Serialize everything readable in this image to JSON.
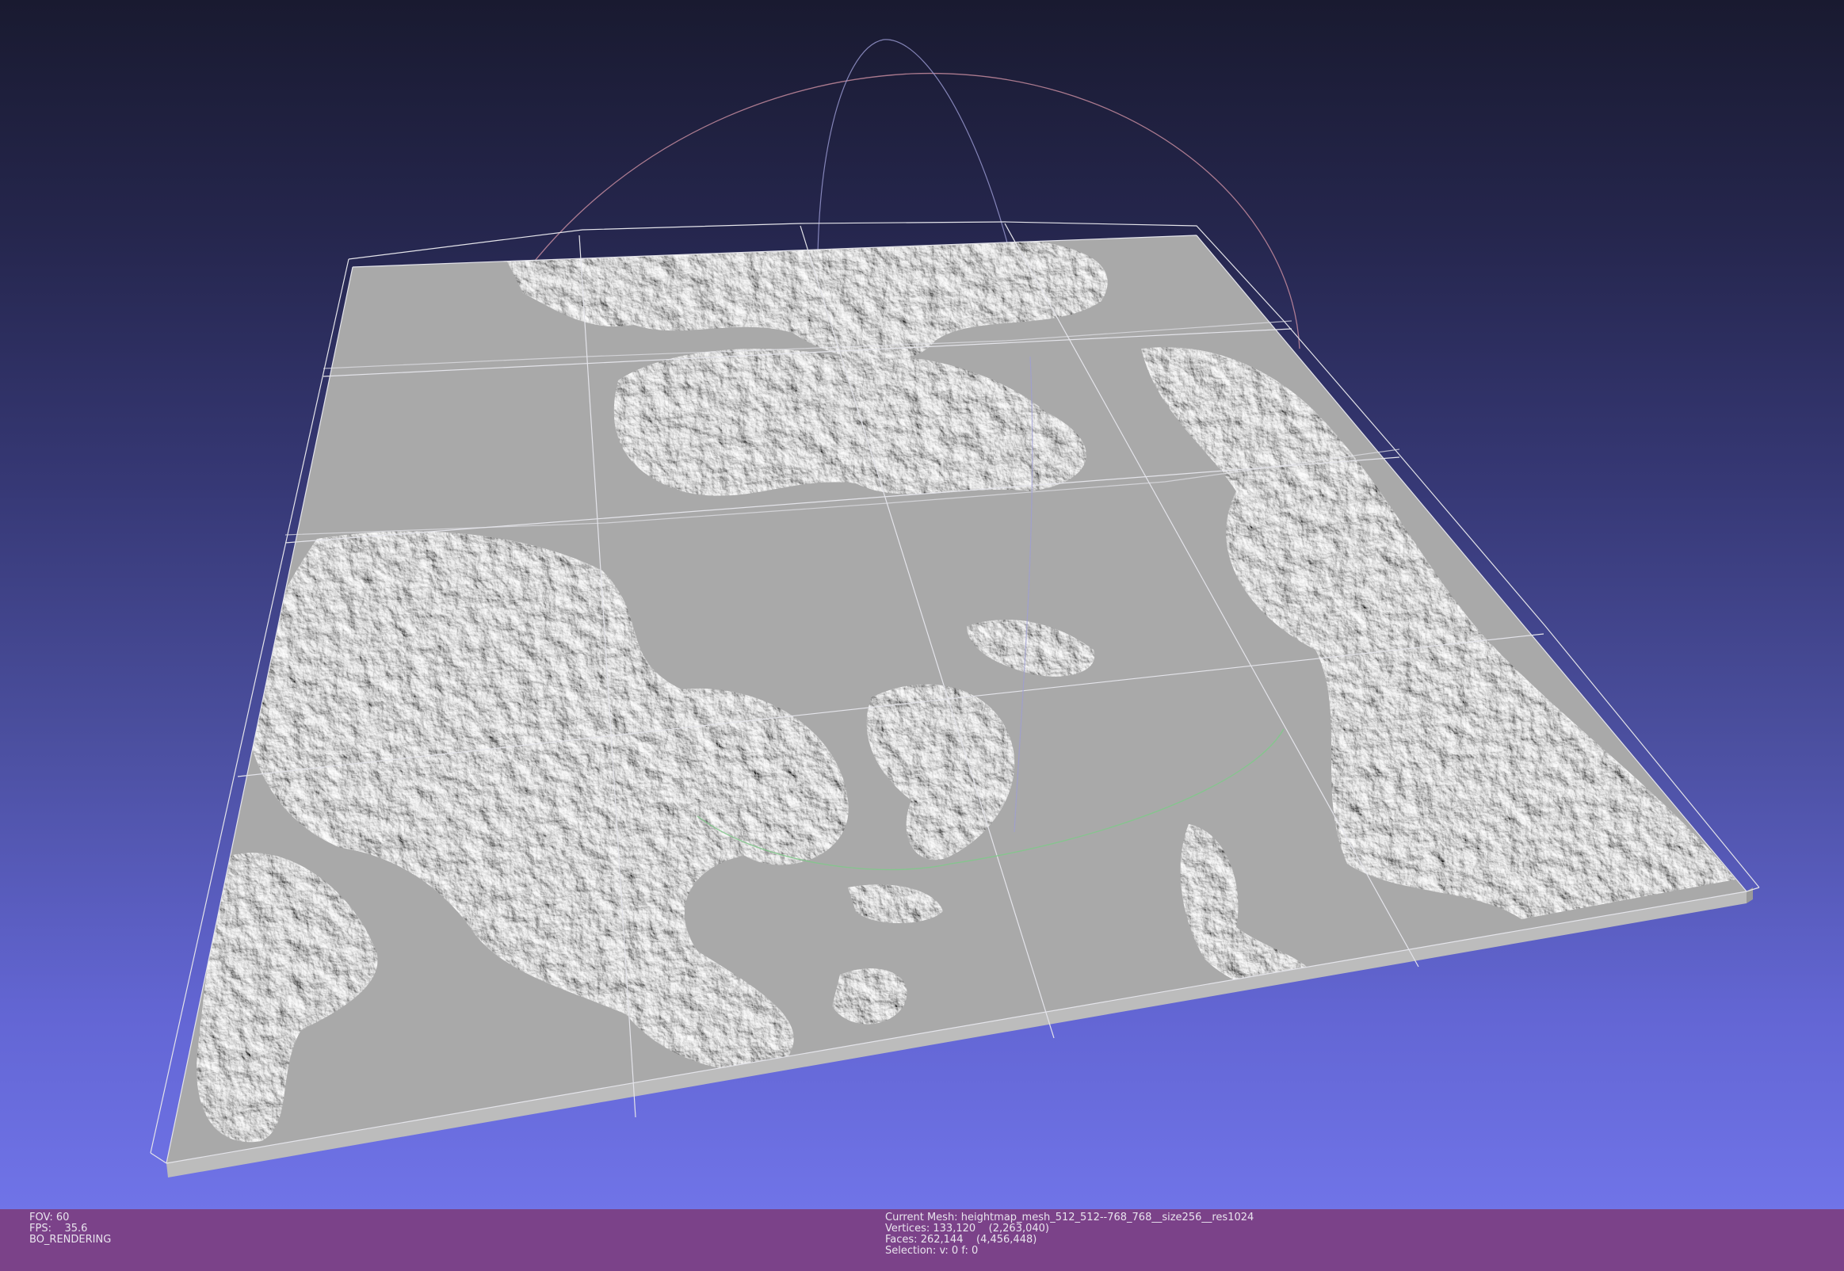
{
  "app": {
    "accent_background_top": "#191a30",
    "accent_background_bottom": "#7478ee",
    "status_bar_color": "#7b4289",
    "mesh_color": "#a9a9a9"
  },
  "viewport": {
    "trackball": {
      "x_ring_color": "#c98c9e",
      "y_ring_color": "#9b9bd9",
      "z_ring_color": "#7fc98a"
    },
    "grid_tiles": {
      "columns": 4,
      "rows": 4
    }
  },
  "status": {
    "fov_label": "FOV:",
    "fov_value": "60",
    "fps_label": "FPS:",
    "fps_value": "35.6",
    "render_mode": "BO_RENDERING",
    "current_mesh_label": "Current Mesh:",
    "current_mesh_name": "heightmap_mesh_512_512--768_768__size256__res1024",
    "vertices_label": "Vertices:",
    "vertices_value": "133,120",
    "vertices_total": "(2,263,040)",
    "faces_label": "Faces:",
    "faces_value": "262,144",
    "faces_total": "(4,456,448)",
    "selection_label": "Selection:",
    "selection_value": "v: 0 f: 0"
  }
}
